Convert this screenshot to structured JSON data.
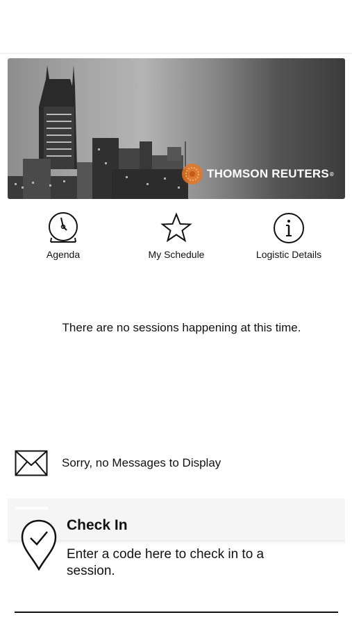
{
  "banner": {
    "brand_text": "THOMSON REUTERS",
    "brand_reg": "®",
    "image_icon": "city-skyline-image",
    "logo_color": "#e87722"
  },
  "quick_nav": [
    {
      "label": "Agenda",
      "icon": "clock-icon"
    },
    {
      "label": "My Schedule",
      "icon": "star-icon"
    },
    {
      "label": "Logistic Details",
      "icon": "info-icon"
    }
  ],
  "sessions": {
    "empty_text": "There are no sessions happening at this time."
  },
  "messages": {
    "icon": "envelope-icon",
    "empty_text": "Sorry, no Messages to Display"
  },
  "check_in": {
    "icon": "location-pin-check-icon",
    "title": "Check In",
    "description": "Enter a code here to check in to a session."
  }
}
